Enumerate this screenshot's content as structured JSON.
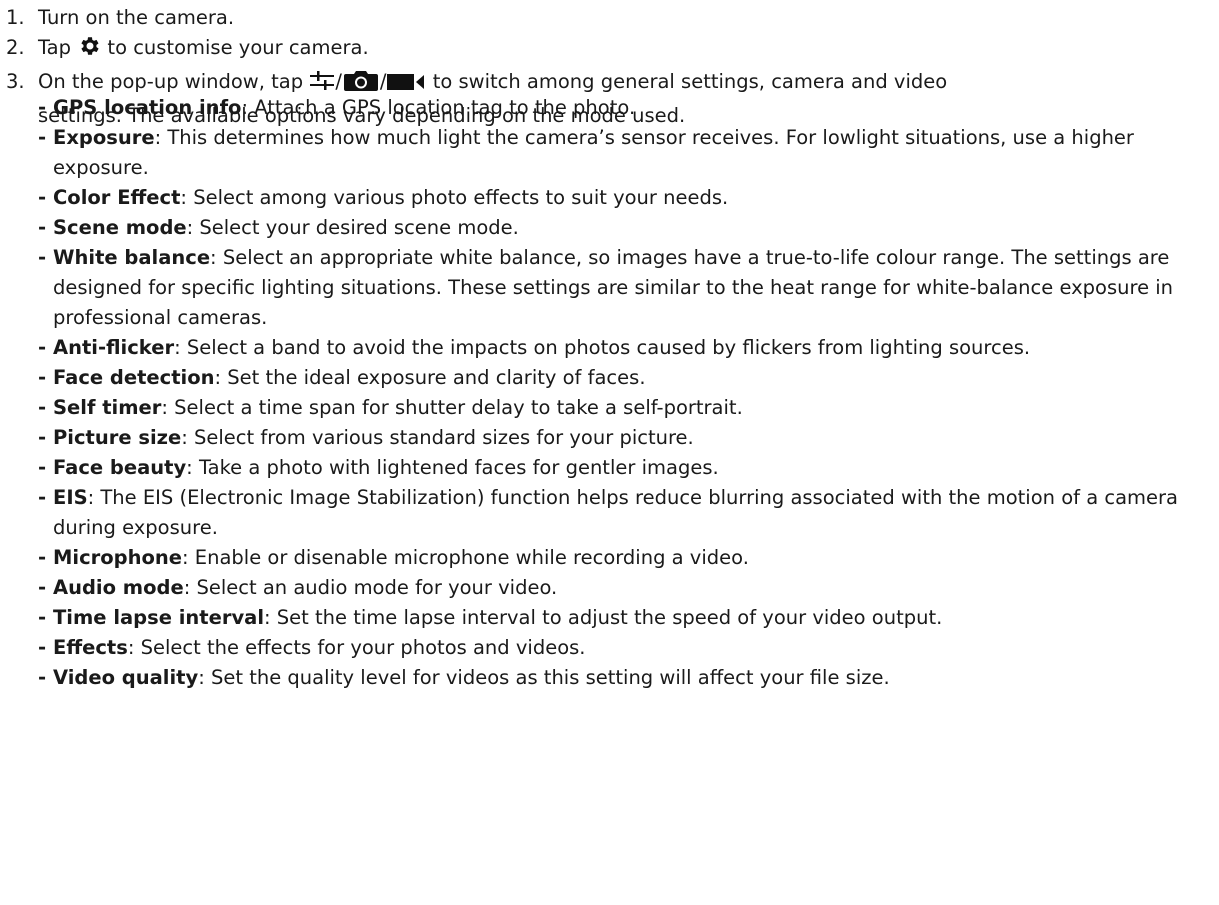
{
  "steps": [
    {
      "num": "1.",
      "text": "Turn on the camera."
    },
    {
      "num": "2.",
      "before": "Tap",
      "icon": "gear-icon",
      "after": "to customise your camera."
    },
    {
      "num": "3.",
      "before": "On the pop-up window, tap",
      "icons": [
        "sliders-icon",
        "camera-icon",
        "video-camera-icon"
      ],
      "separator": "/",
      "after": "to switch among general settings, camera and video",
      "continuation": "settings. The available options vary depending on the mode used."
    }
  ],
  "options": [
    {
      "name": "GPS location info",
      "desc": ": Attach a GPS location tag to the photo."
    },
    {
      "name": "Exposure",
      "desc": ": This determines how much light the camera’s sensor receives. For lowlight situations, use a higher exposure."
    },
    {
      "name": "Color Effect",
      "desc": ": Select among various photo effects to suit your needs."
    },
    {
      "name": "Scene mode",
      "desc": ": Select your desired scene mode."
    },
    {
      "name": "White balance",
      "desc": ": Select an appropriate white balance, so images have a true-to-life colour range. The settings are designed for specific lighting situations. These settings are similar to the heat range for white-balance exposure in professional cameras."
    },
    {
      "name": "Anti-flicker",
      "desc": ": Select a band to avoid the impacts on photos caused by flickers from lighting sources."
    },
    {
      "name": "Face detection",
      "desc": ": Set the ideal exposure and clarity of faces."
    },
    {
      "name": "Self timer",
      "desc": ": Select a time span for shutter delay to take a self-portrait."
    },
    {
      "name": "Picture size",
      "desc": ": Select from various standard sizes for your picture."
    },
    {
      "name": "Face beauty",
      "desc": ": Take a photo with lightened faces for gentler images."
    },
    {
      "name": "EIS",
      "desc": ": The EIS (Electronic Image Stabilization) function helps reduce blurring associated with the motion of a camera during exposure."
    },
    {
      "name": "Microphone",
      "desc": ": Enable or disenable microphone while recording a video."
    },
    {
      "name": "Audio mode",
      "desc": ": Select an audio mode for your video."
    },
    {
      "name": "Time lapse interval",
      "desc": ": Set the time lapse interval to adjust the speed of your video output."
    },
    {
      "name": "Effects",
      "desc": ": Select the effects for your photos and videos."
    },
    {
      "name": "Video quality",
      "desc": ": Set the quality level for videos as this setting will affect your file size."
    }
  ],
  "dash": "-",
  "colors": {
    "text": "#1a1a1a",
    "icon": "#111111"
  }
}
